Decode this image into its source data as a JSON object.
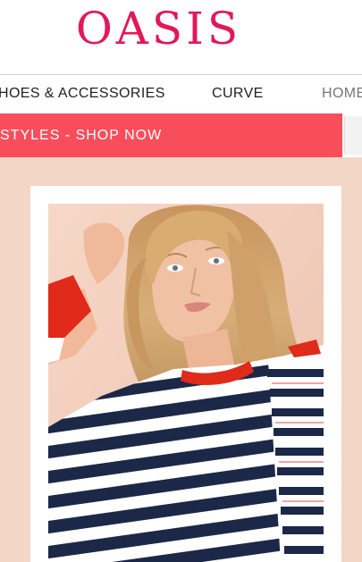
{
  "brand": {
    "logo_text": "OASIS",
    "accent_color": "#e2185a"
  },
  "nav": {
    "items": [
      {
        "label": "HOES & ACCESSORIES"
      },
      {
        "label": "CURVE"
      },
      {
        "label": "HOME"
      }
    ]
  },
  "promo": {
    "text": "STYLES - SHOP NOW",
    "color": "#f84e5c"
  },
  "hero": {
    "image_icon": "model-photo",
    "background_color": "#f4d6c6"
  }
}
